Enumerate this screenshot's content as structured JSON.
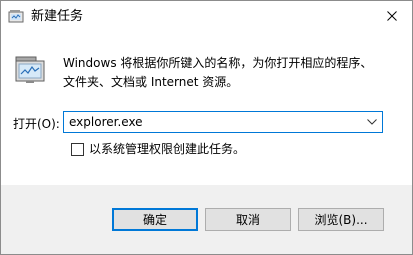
{
  "window": {
    "title": "新建任务"
  },
  "dialog": {
    "description_line1": "Windows 将根据你所键入的名称，为你打开相应的程序、",
    "description_line2": "文件夹、文档或 Internet 资源。",
    "open_label": "打开(O):",
    "open_value": "explorer.exe",
    "admin_checkbox_label": "以系统管理权限创建此任务。",
    "admin_checked": false
  },
  "buttons": {
    "ok": "确定",
    "cancel": "取消",
    "browse": "浏览(B)..."
  },
  "icons": {
    "title": "run-icon",
    "main": "run-program-icon",
    "close": "close-icon",
    "dropdown": "chevron-down-icon"
  },
  "colors": {
    "accent": "#0078d7",
    "footer_bg": "#f0f0f0",
    "button_bg": "#e1e1e1"
  }
}
